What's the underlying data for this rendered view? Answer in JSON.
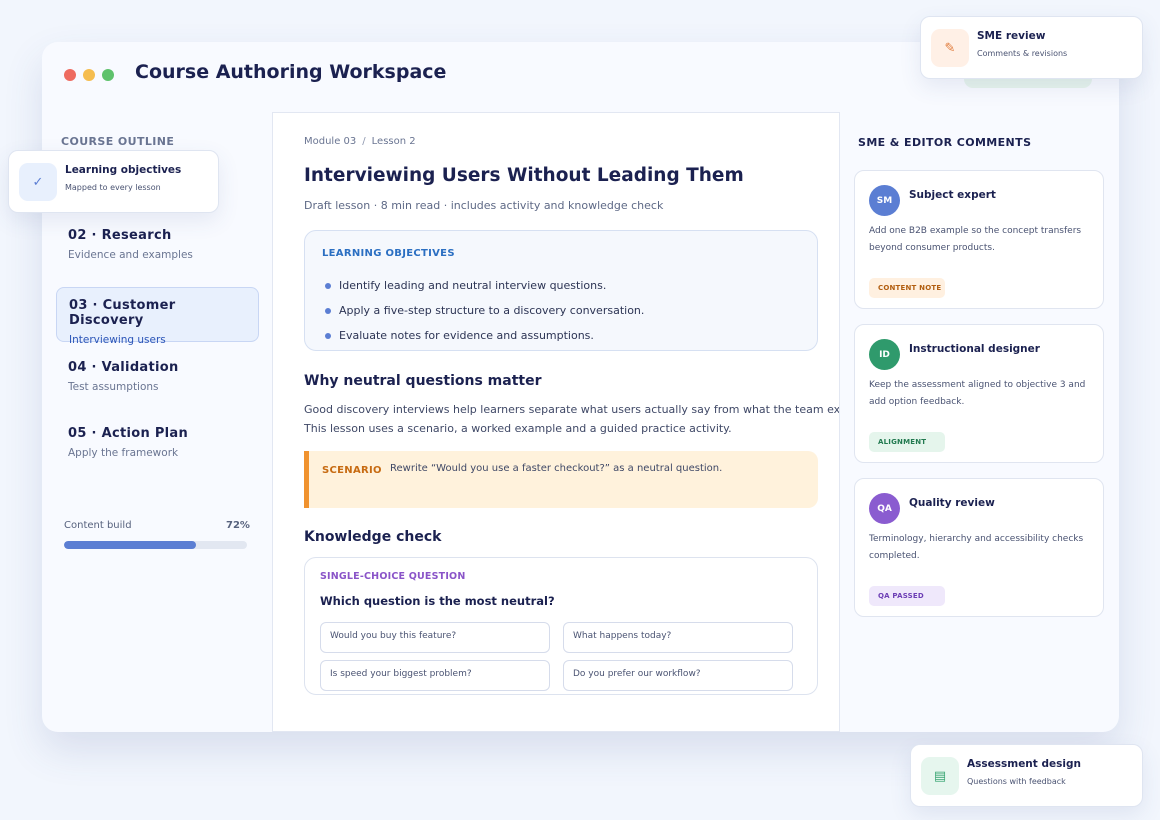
{
  "app": {
    "title": "Course Authoring Workspace",
    "colors": {
      "accent": "#5b7ed3",
      "background": "#f2f6fd",
      "scenario": "#fff2dc"
    }
  },
  "sidebar": {
    "heading": "COURSE OUTLINE",
    "items": [
      {
        "title": "02 · Research",
        "subtitle": "Evidence and examples",
        "active": false
      },
      {
        "title": "03 · Customer Discovery",
        "subtitle": "Interviewing users",
        "active": true
      },
      {
        "title": "04 · Validation",
        "subtitle": "Test assumptions",
        "active": false
      },
      {
        "title": "05 · Action Plan",
        "subtitle": "Apply the framework",
        "active": false
      }
    ],
    "progress": {
      "label": "Content build",
      "value_text": "72%",
      "value": 0.72
    }
  },
  "lesson": {
    "breadcrumb": {
      "module": "Module 03",
      "separator": "/",
      "lesson": "Lesson 2"
    },
    "title": "Interviewing Users Without Leading Them",
    "meta": "Draft lesson · 8 min read · includes activity and knowledge check",
    "objectives": {
      "heading": "LEARNING OBJECTIVES",
      "items": [
        "Identify leading and neutral interview questions.",
        "Apply a five-step structure to a discovery conversation.",
        "Evaluate notes for evidence and assumptions."
      ]
    },
    "section1_heading": "Why neutral questions matter",
    "paragraph_line1": "Good discovery interviews help learners separate what users actually say from what the team ex",
    "paragraph_line2": "This lesson uses a scenario, a worked example and a guided practice activity.",
    "scenario": {
      "label": "SCENARIO",
      "text": "Rewrite “Would you use a faster checkout?” as a neutral question."
    },
    "section2_heading": "Knowledge check",
    "quiz": {
      "type_label": "SINGLE-CHOICE QUESTION",
      "question": "Which question is the most neutral?",
      "options": [
        "Would you buy this feature?",
        "What happens today?",
        "Is speed your biggest problem?",
        "Do you prefer our workflow?"
      ]
    }
  },
  "comments": {
    "heading": "SME & EDITOR COMMENTS",
    "cards": [
      {
        "initials": "SM",
        "name": "Subject expert",
        "text": "Add one B2B example so the concept transfers beyond consumer products.",
        "tag": "CONTENT NOTE",
        "avatar_color": "#5b7ed3",
        "tag_bg": "#fff0e0",
        "tag_color": "#b25e10"
      },
      {
        "initials": "ID",
        "name": "Instructional designer",
        "text": "Keep the assessment aligned to objective 3 and add option feedback.",
        "tag": "ALIGNMENT",
        "avatar_color": "#2f9a6c",
        "tag_bg": "#e5f5ec",
        "tag_color": "#227a50"
      },
      {
        "initials": "QA",
        "name": "Quality review",
        "text": "Terminology, hierarchy and accessibility checks completed.",
        "tag": "QA PASSED",
        "avatar_color": "#8a5cd0",
        "tag_bg": "#efe8fb",
        "tag_color": "#6d3fb5"
      }
    ]
  },
  "floating": {
    "objectives": {
      "title": "Learning objectives",
      "subtitle": "Mapped to every lesson",
      "icon": "check-icon"
    },
    "sme": {
      "title": "SME review",
      "subtitle": "Comments & revisions",
      "icon": "pencil-icon"
    },
    "assessment": {
      "title": "Assessment design",
      "subtitle": "Questions with feedback",
      "icon": "list-icon"
    }
  }
}
